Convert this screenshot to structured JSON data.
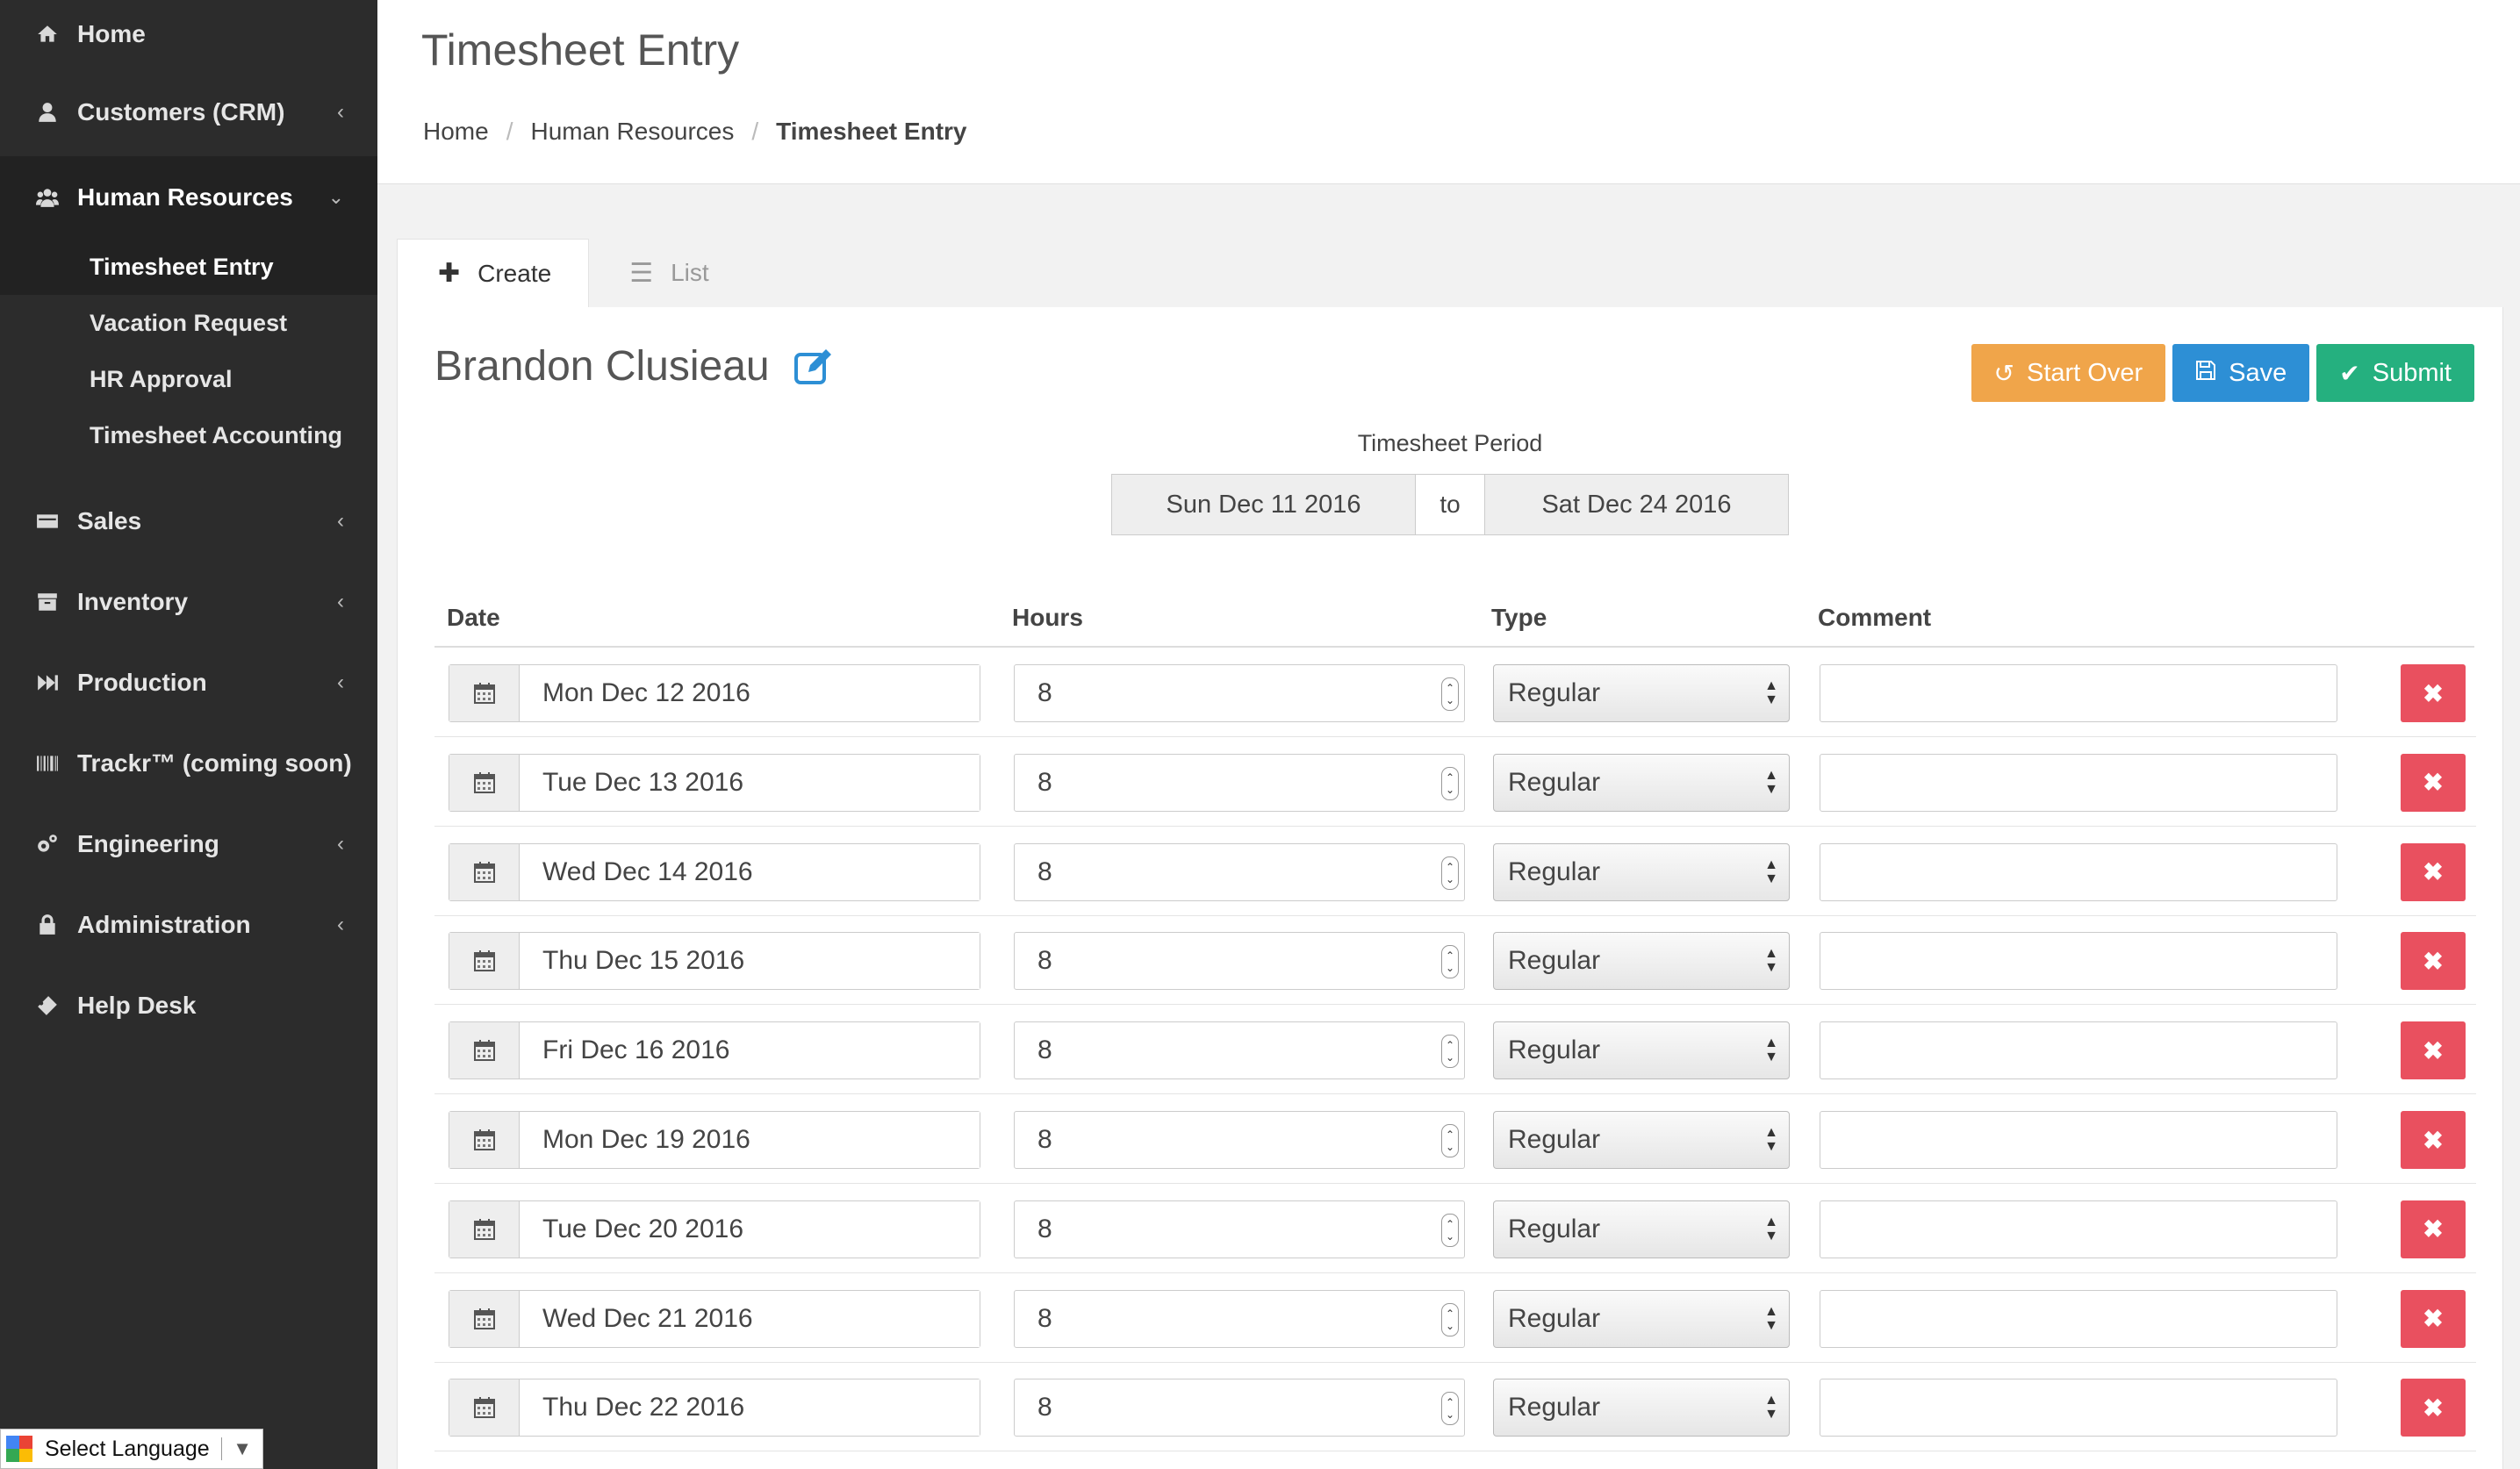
{
  "sidebar": {
    "items": [
      {
        "label": "Home",
        "icon": "home-icon"
      },
      {
        "label": "Customers (CRM)",
        "icon": "user-icon"
      },
      {
        "label": "Human Resources",
        "icon": "users-icon"
      },
      {
        "label": "Sales",
        "icon": "credit-card-icon"
      },
      {
        "label": "Inventory",
        "icon": "archive-icon"
      },
      {
        "label": "Production",
        "icon": "fast-forward-icon"
      },
      {
        "label": "Trackr™ (coming soon)",
        "icon": "barcode-icon"
      },
      {
        "label": "Engineering",
        "icon": "cogs-icon"
      },
      {
        "label": "Administration",
        "icon": "lock-icon"
      },
      {
        "label": "Help Desk",
        "icon": "ticket-icon"
      }
    ],
    "hr_sub": [
      "Timesheet Entry",
      "Vacation Request",
      "HR Approval",
      "Timesheet Accounting"
    ]
  },
  "language": {
    "label": "Select Language"
  },
  "header": {
    "title": "Timesheet Entry",
    "breadcrumb": [
      "Home",
      "Human Resources",
      "Timesheet Entry"
    ]
  },
  "tabs": {
    "create": "Create",
    "list": "List"
  },
  "employee": {
    "name": "Brandon Clusieau"
  },
  "actions": {
    "start_over": "Start Over",
    "save": "Save",
    "submit": "Submit"
  },
  "period": {
    "label": "Timesheet Period",
    "from": "Sun Dec 11 2016",
    "to_word": "to",
    "to": "Sat Dec 24 2016"
  },
  "table": {
    "headers": {
      "date": "Date",
      "hours": "Hours",
      "type": "Type",
      "comment": "Comment"
    },
    "rows": [
      {
        "date": "Mon Dec 12 2016",
        "hours": "8",
        "type": "Regular",
        "comment": ""
      },
      {
        "date": "Tue Dec 13 2016",
        "hours": "8",
        "type": "Regular",
        "comment": ""
      },
      {
        "date": "Wed Dec 14 2016",
        "hours": "8",
        "type": "Regular",
        "comment": ""
      },
      {
        "date": "Thu Dec 15 2016",
        "hours": "8",
        "type": "Regular",
        "comment": ""
      },
      {
        "date": "Fri Dec 16 2016",
        "hours": "8",
        "type": "Regular",
        "comment": ""
      },
      {
        "date": "Mon Dec 19 2016",
        "hours": "8",
        "type": "Regular",
        "comment": ""
      },
      {
        "date": "Tue Dec 20 2016",
        "hours": "8",
        "type": "Regular",
        "comment": ""
      },
      {
        "date": "Wed Dec 21 2016",
        "hours": "8",
        "type": "Regular",
        "comment": ""
      },
      {
        "date": "Thu Dec 22 2016",
        "hours": "8",
        "type": "Regular",
        "comment": ""
      }
    ]
  },
  "colors": {
    "sidebar_bg": "#2c2c2c",
    "orange": "#f0a54a",
    "blue": "#2d8fd5",
    "green": "#25b07f",
    "danger": "#e9505f"
  }
}
